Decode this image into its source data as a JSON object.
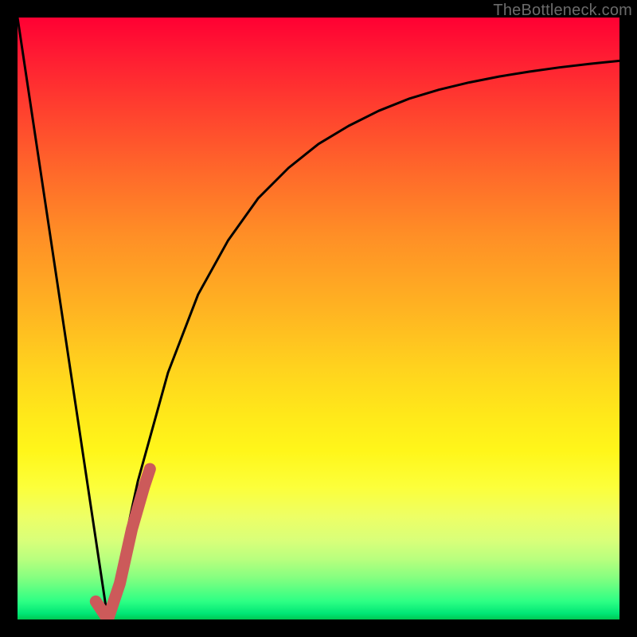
{
  "watermark": "TheBottleneck.com",
  "colors": {
    "page_bg": "#000000",
    "gradient_top": "#ff0033",
    "gradient_mid1": "#ff8e26",
    "gradient_mid2": "#ffe81a",
    "gradient_bottom": "#00c853",
    "curve_stroke": "#000000",
    "highlight_stroke": "#cc5a5a"
  },
  "chart_data": {
    "type": "line",
    "title": "",
    "xlabel": "",
    "ylabel": "",
    "xlim": [
      0,
      100
    ],
    "ylim": [
      0,
      100
    ],
    "grid": false,
    "legend": false,
    "annotations": [],
    "series": [
      {
        "name": "left-descending-line",
        "x": [
          0,
          15
        ],
        "values": [
          100,
          0
        ]
      },
      {
        "name": "right-rising-curve",
        "x": [
          15,
          20,
          25,
          30,
          35,
          40,
          45,
          50,
          55,
          60,
          65,
          70,
          75,
          80,
          85,
          90,
          95,
          100
        ],
        "values": [
          0,
          23,
          41,
          54,
          63,
          70,
          75,
          79,
          82,
          84.5,
          86.5,
          88,
          89.2,
          90.2,
          91,
          91.7,
          92.3,
          92.8
        ]
      },
      {
        "name": "highlight-J-segment",
        "x": [
          13,
          15,
          17,
          19,
          21,
          22
        ],
        "values": [
          3,
          0,
          6,
          15,
          22,
          25
        ]
      }
    ]
  }
}
